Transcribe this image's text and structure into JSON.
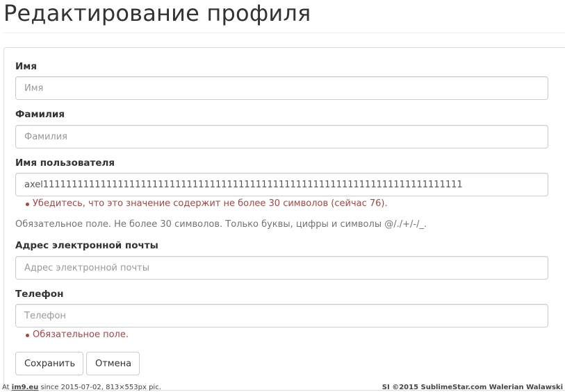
{
  "header": {
    "title": "Редактирование профиля"
  },
  "form": {
    "first_name": {
      "label": "Имя",
      "placeholder": "Имя",
      "value": ""
    },
    "last_name": {
      "label": "Фамилия",
      "placeholder": "Фамилия",
      "value": ""
    },
    "username": {
      "label": "Имя пользователя",
      "value": "axel1111111111111111111111111111111111111111111111111111111111111111111111111",
      "error": "Убедитесь, что это значение содержит не более 30 символов (сейчас 76).",
      "help": "Обязательное поле. Не более 30 символов. Только буквы, цифры и символы @/./+/-/_."
    },
    "email": {
      "label": "Адрес электронной почты",
      "placeholder": "Адрес электронной почты",
      "value": ""
    },
    "phone": {
      "label": "Телефон",
      "placeholder": "Телефон",
      "value": "",
      "error": "Обязательное поле."
    },
    "buttons": {
      "save": "Сохранить",
      "cancel": "Отмена"
    }
  },
  "footer": {
    "left_prefix": "At ",
    "left_link": "im9.eu",
    "left_suffix": " since 2015-07-02, 813×553px pic.",
    "right": "SI ©2015 SublimeStar.com Walerian Walawski"
  },
  "colors": {
    "error": "#a94442",
    "border": "#cccccc",
    "text": "#333333"
  }
}
